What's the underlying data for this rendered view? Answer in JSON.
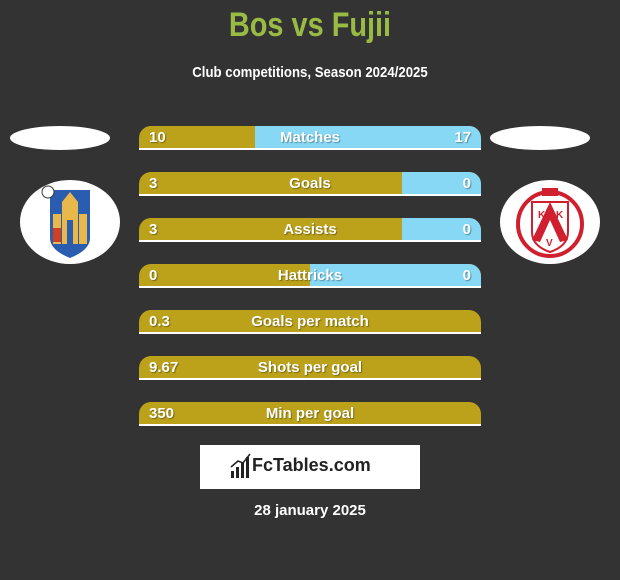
{
  "header": {
    "title": "Bos vs Fujii",
    "subtitle": "Club competitions, Season 2024/2025"
  },
  "teams": {
    "left": {
      "name": "Bos",
      "logo_icon": "westerlo-crest-icon"
    },
    "right": {
      "name": "Fujii",
      "logo_icon": "kortrijk-crest-icon"
    }
  },
  "colors": {
    "background": "#333333",
    "title": "#99bb44",
    "left_bar": "#bba21a",
    "right_bar": "#87d8f5"
  },
  "stats": [
    {
      "label": "Matches",
      "left": "10",
      "right": "17",
      "left_share": 0.34
    },
    {
      "label": "Goals",
      "left": "3",
      "right": "0",
      "left_share": 0.77
    },
    {
      "label": "Assists",
      "left": "3",
      "right": "0",
      "left_share": 0.77
    },
    {
      "label": "Hattricks",
      "left": "0",
      "right": "0",
      "left_share": 0.5
    },
    {
      "label": "Goals per match",
      "left": "0.3",
      "right": null,
      "left_share": 1.0
    },
    {
      "label": "Shots per goal",
      "left": "9.67",
      "right": null,
      "left_share": 1.0
    },
    {
      "label": "Min per goal",
      "left": "350",
      "right": null,
      "left_share": 1.0
    }
  ],
  "brand": {
    "name": "FcTables.com",
    "icon": "bar-chart-icon"
  },
  "footer": {
    "date": "28 january 2025"
  }
}
